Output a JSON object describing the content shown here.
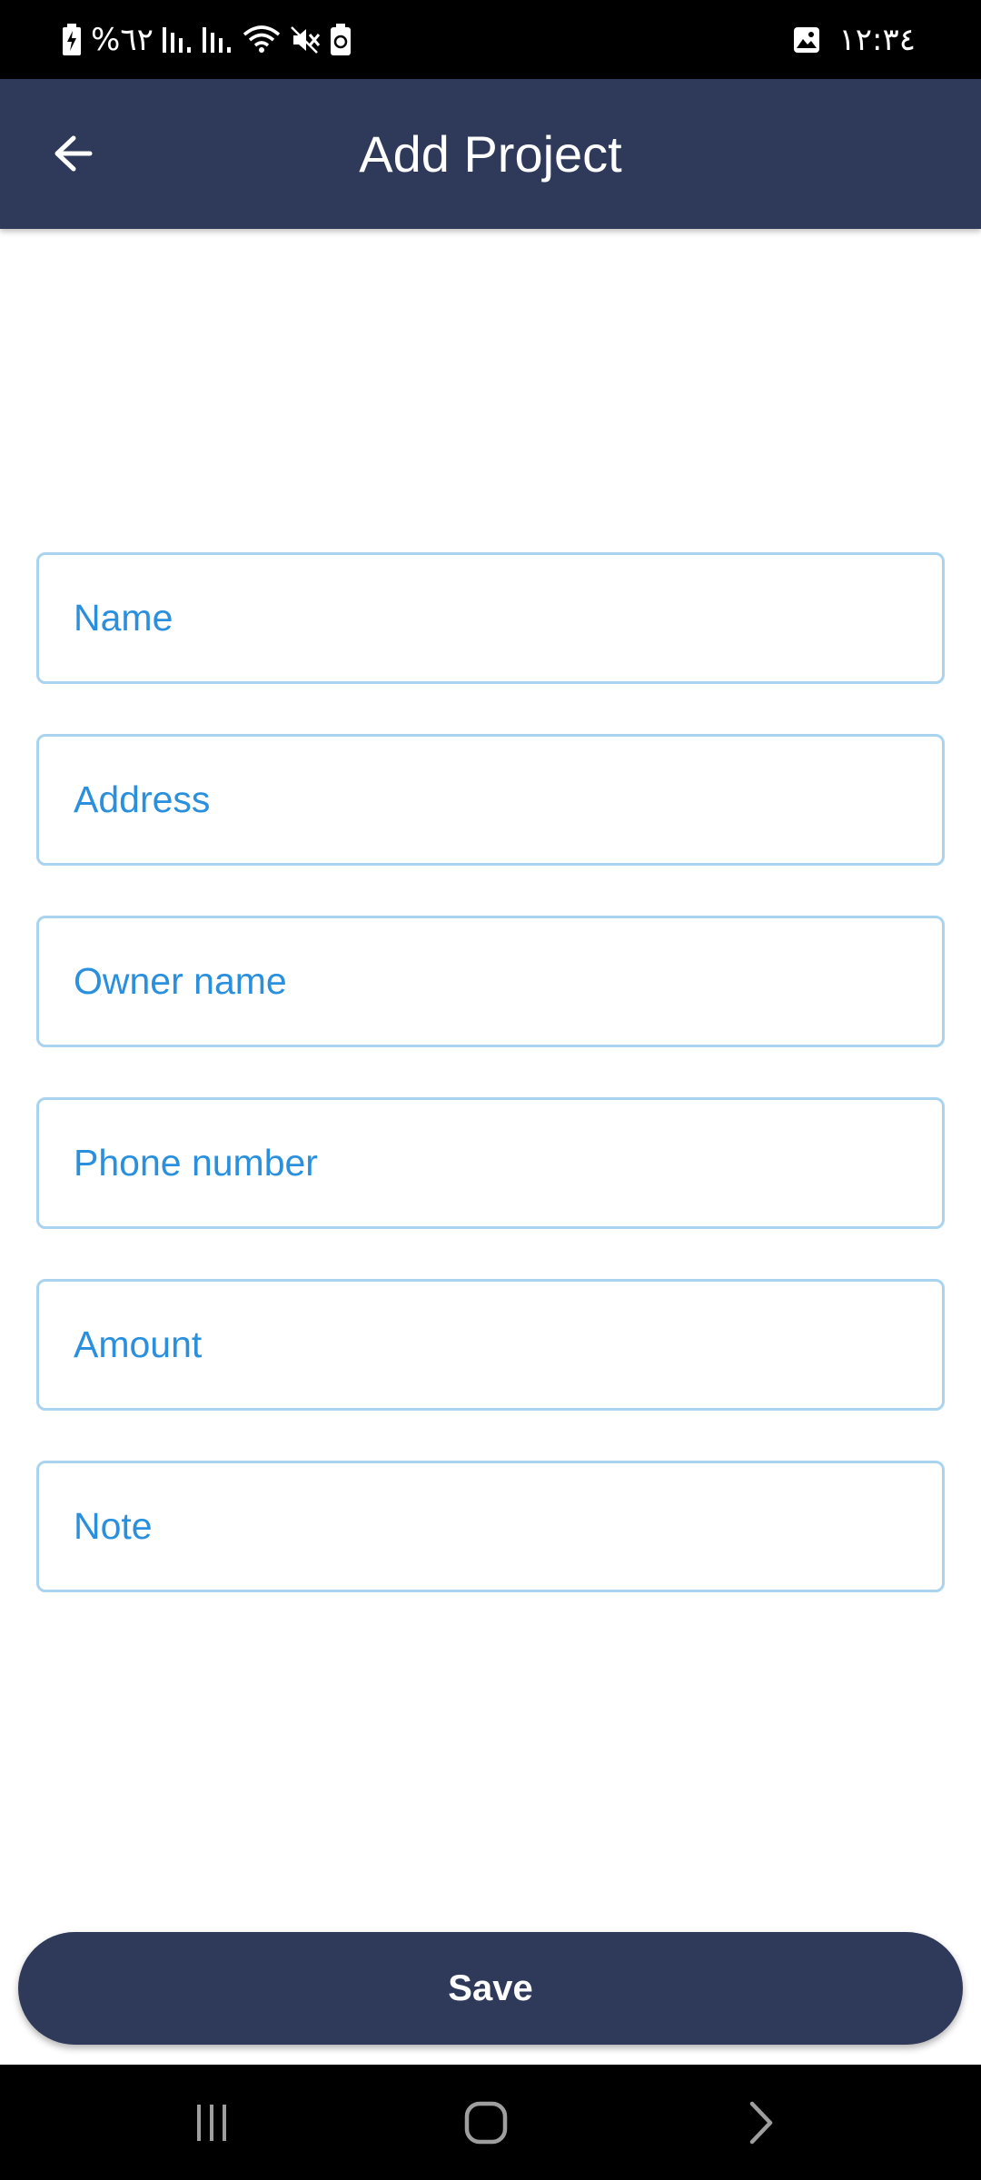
{
  "status_bar": {
    "battery_text": "%٦٢",
    "time": "١٢:٣٤",
    "icons": [
      "battery-charging-icon",
      "signal-icon",
      "signal-icon",
      "wifi-icon",
      "mute-icon",
      "recycle-battery-icon",
      "gallery-icon"
    ]
  },
  "app_bar": {
    "title": "Add Project",
    "back_icon": "arrow-left-icon"
  },
  "form": {
    "name_placeholder": "Name",
    "address_placeholder": "Address",
    "owner_placeholder": "Owner name",
    "phone_placeholder": "Phone number",
    "amount_placeholder": "Amount",
    "note_placeholder": "Note"
  },
  "save_label": "Save",
  "nav_bar": {
    "icons": [
      "recents-icon",
      "home-icon",
      "back-chevron-icon"
    ]
  },
  "colors": {
    "app_bar": "#2f395a",
    "field_border": "#a9d3ef",
    "field_text": "#2a8fdc",
    "background": "#ffffff"
  }
}
